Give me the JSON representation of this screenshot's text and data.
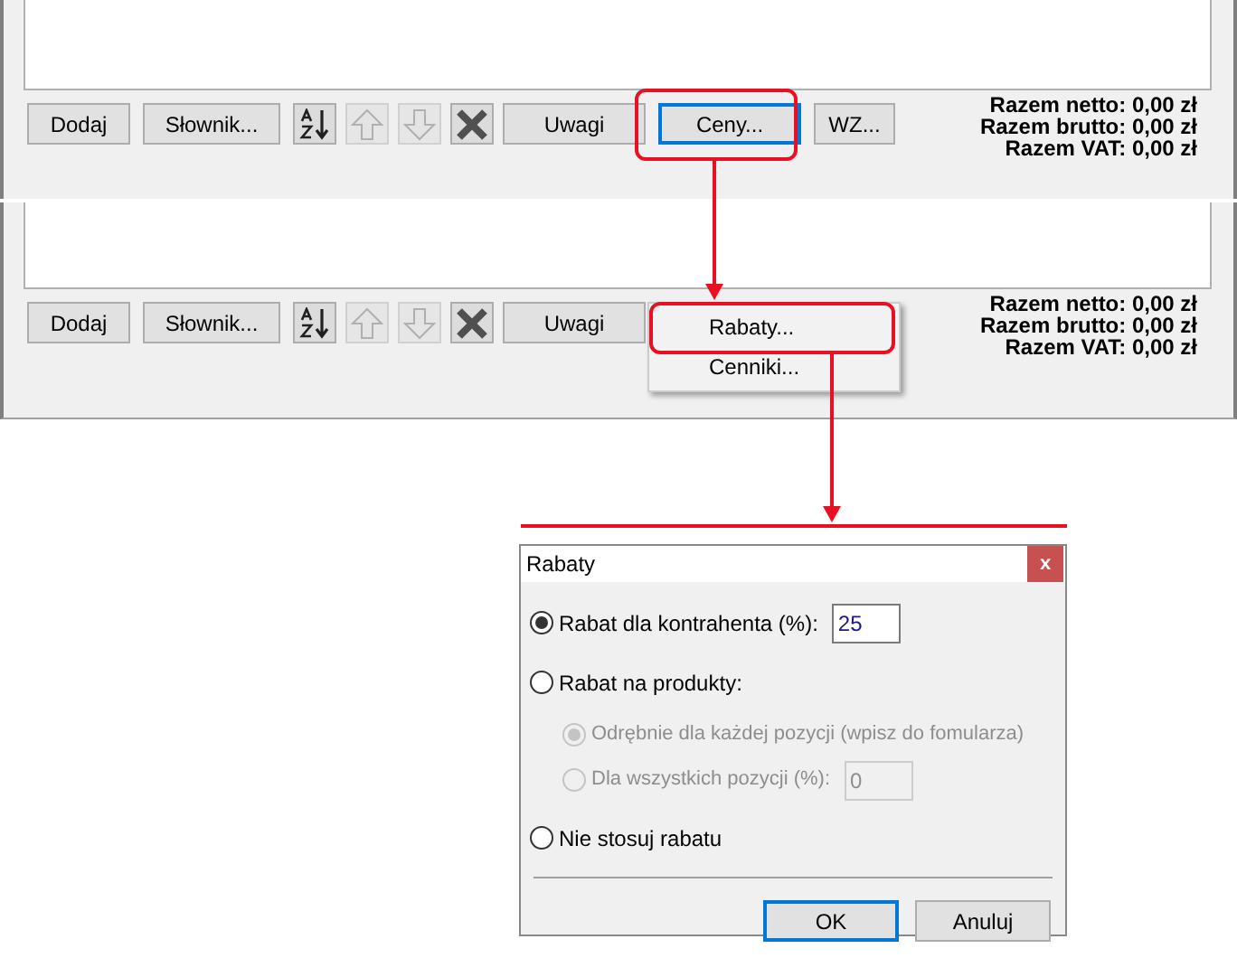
{
  "panels": [
    {
      "buttons": [
        {
          "kind": "text",
          "label": "Dodaj",
          "disabled": false,
          "focused": false
        },
        {
          "kind": "text",
          "label": "Słownik...",
          "disabled": false,
          "focused": false
        },
        {
          "kind": "sort",
          "disabled": false,
          "focused": false
        },
        {
          "kind": "up",
          "disabled": true,
          "focused": false
        },
        {
          "kind": "down",
          "disabled": true,
          "focused": false
        },
        {
          "kind": "delete",
          "disabled": false,
          "focused": false
        },
        {
          "kind": "text",
          "label": "Uwagi",
          "disabled": false,
          "focused": false
        },
        {
          "kind": "text",
          "label": "Ceny...",
          "disabled": false,
          "focused": true
        },
        {
          "kind": "text",
          "label": "WZ...",
          "disabled": false,
          "focused": false
        }
      ],
      "totals": [
        "Razem netto: 0,00 zł",
        "Razem brutto: 0,00 zł",
        "Razem VAT: 0,00 zł"
      ]
    },
    {
      "buttons": [
        {
          "kind": "text",
          "label": "Dodaj",
          "disabled": false,
          "focused": false
        },
        {
          "kind": "text",
          "label": "Słownik...",
          "disabled": false,
          "focused": false
        },
        {
          "kind": "sort",
          "disabled": false,
          "focused": false
        },
        {
          "kind": "up",
          "disabled": true,
          "focused": false
        },
        {
          "kind": "down",
          "disabled": true,
          "focused": false
        },
        {
          "kind": "delete",
          "disabled": false,
          "focused": false
        },
        {
          "kind": "text",
          "label": "Uwagi",
          "disabled": false,
          "focused": false
        }
      ],
      "menu": [
        "Rabaty...",
        "Cenniki..."
      ],
      "totals": [
        "Razem netto: 0,00 zł",
        "Razem brutto: 0,00 zł",
        "Razem VAT: 0,00 zł"
      ]
    }
  ],
  "dialog": {
    "title": "Rabaty",
    "close": "x",
    "options": [
      {
        "label": "Rabat dla kontrahenta (%):",
        "selected": true,
        "disabled": false,
        "value": "25"
      },
      {
        "label": "Rabat na produkty:",
        "selected": false,
        "disabled": false,
        "children": [
          {
            "label": "Odrębnie dla każdej pozycji (wpisz do fomularza)",
            "selected": true,
            "disabled": true
          },
          {
            "label": "Dla wszystkich pozycji (%):",
            "selected": false,
            "disabled": true,
            "value": "0"
          }
        ]
      },
      {
        "label": "Nie stosuj rabatu",
        "selected": false,
        "disabled": false
      }
    ],
    "buttons": [
      {
        "label": "OK",
        "default": true
      },
      {
        "label": "Anuluj",
        "default": false
      }
    ]
  }
}
